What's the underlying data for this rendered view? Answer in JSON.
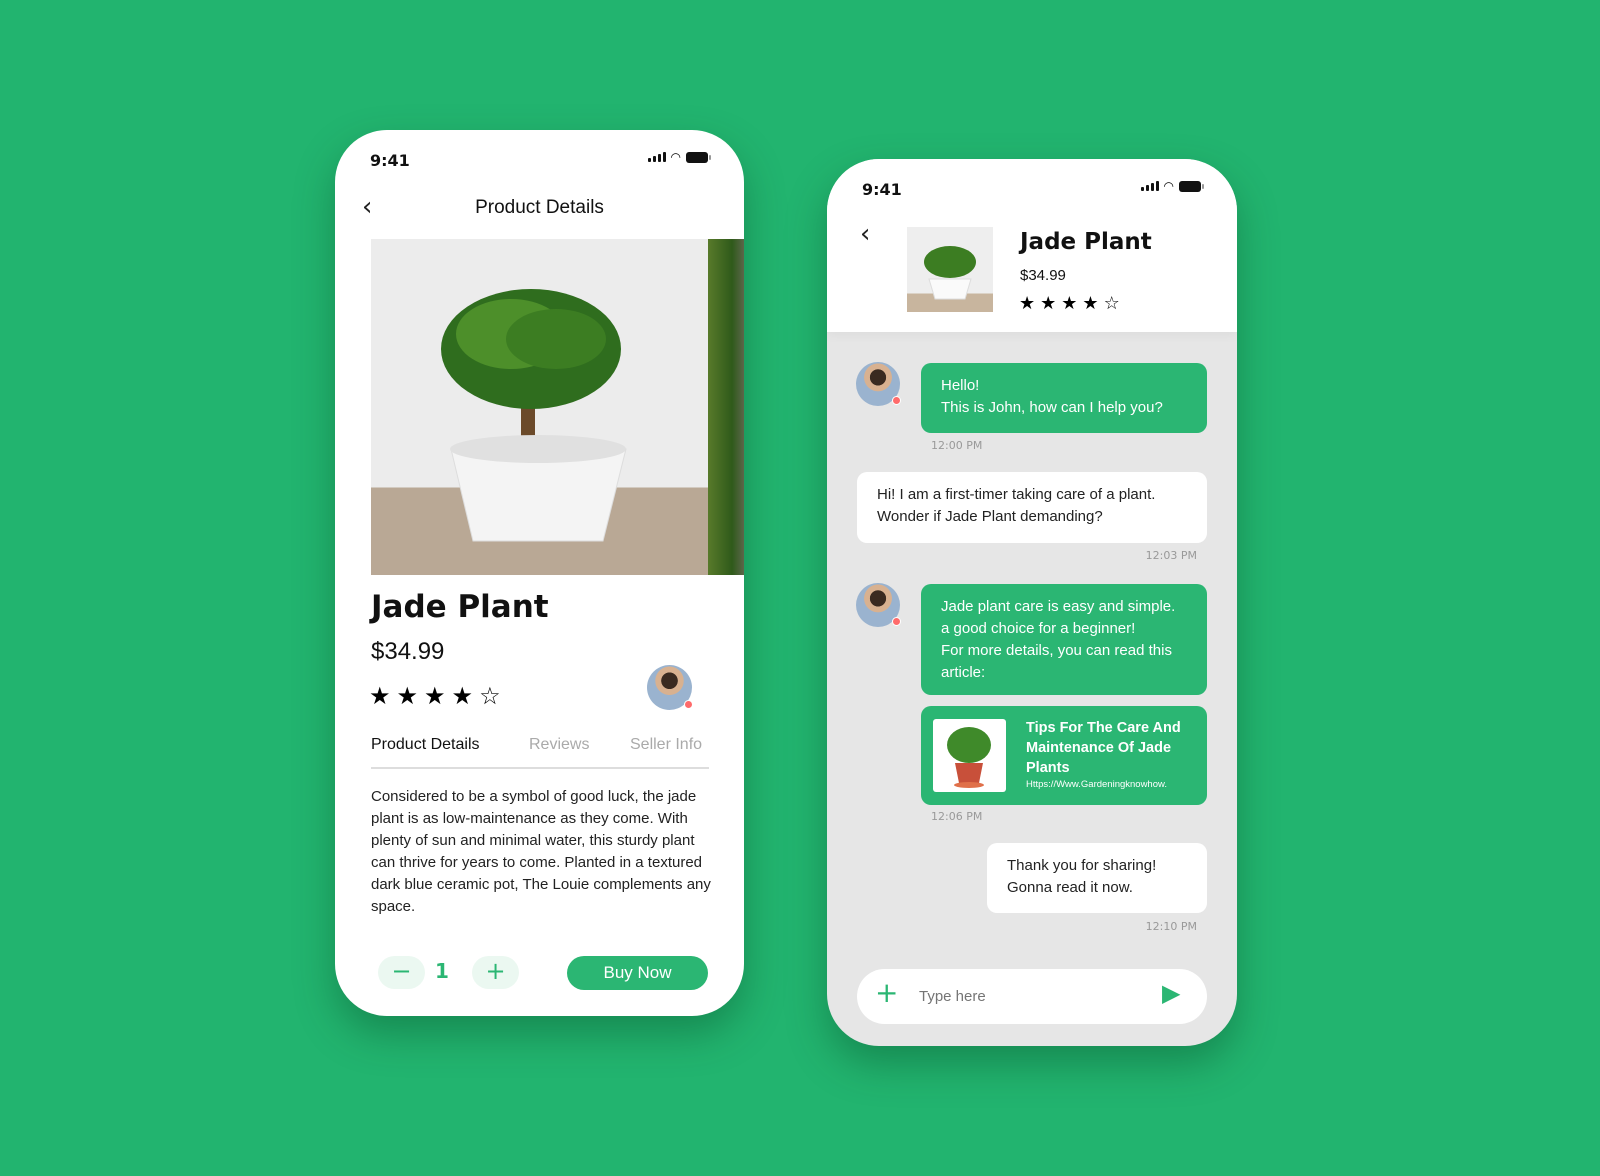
{
  "colors": {
    "background": "#22b46f",
    "accent": "#2bb673",
    "online_dot": "#ff6b6b"
  },
  "status_bar": {
    "time": "9:41"
  },
  "product_screen": {
    "header_title": "Product Details",
    "name": "Jade Plant",
    "price": "$34.99",
    "rating": 4,
    "rating_max": 5,
    "tabs": [
      {
        "label": "Product Details",
        "active": true
      },
      {
        "label": "Reviews",
        "active": false
      },
      {
        "label": "Seller Info",
        "active": false
      }
    ],
    "description": "Considered to be a symbol of good luck, the jade plant is as low-maintenance as they come. With plenty of sun and minimal water, this sturdy plant can thrive for years to come. Planted in a textured dark blue ceramic pot, The Louie complements any space.",
    "quantity": "1",
    "buy_label": "Buy Now"
  },
  "chat_screen": {
    "product_name": "Jade Plant",
    "product_price": "$34.99",
    "rating": 4,
    "messages": [
      {
        "from": "seller",
        "lines": [
          "Hello!",
          "This is John, how can I help you?"
        ],
        "time": "12:00 PM"
      },
      {
        "from": "user",
        "lines": [
          "Hi! I am a first-timer taking care of a plant.",
          "Wonder if Jade Plant demanding?"
        ],
        "time": "12:03 PM"
      },
      {
        "from": "seller",
        "lines": [
          "Jade plant care is easy and simple.",
          "a good choice for a beginner!",
          "For more details, you can read this",
          "article:"
        ]
      },
      {
        "from": "seller",
        "link": {
          "title": "Tips For The Care And Maintenance Of Jade Plants",
          "url": "Https://Www.Gardeningknowhow."
        },
        "time": "12:06 PM"
      },
      {
        "from": "user",
        "lines": [
          "Thank you for sharing!",
          "Gonna read it now."
        ],
        "time": "12:10 PM"
      }
    ],
    "input_placeholder": "Type here"
  }
}
